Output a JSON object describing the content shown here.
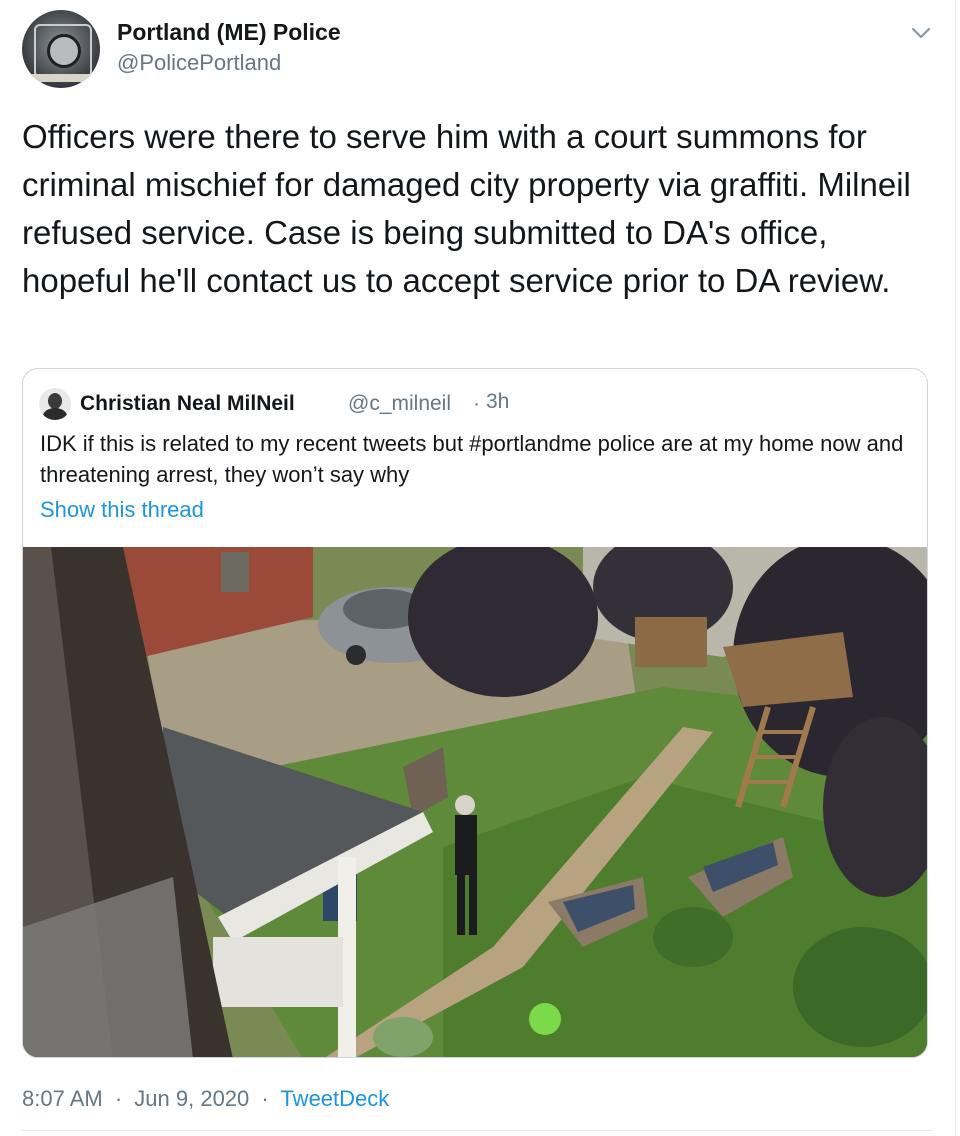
{
  "tweet": {
    "author": {
      "name": "Portland (ME) Police",
      "handle": "@PolicePortland",
      "avatar_icon": "police-badge-avatar"
    },
    "menu_icon": "chevron-down-icon",
    "text": "Officers were there to serve him with a court summons for criminal mischief for damaged city property via graffiti. Milneil refused service. Case is being submitted to DA's office, hopeful he'll contact us to accept service prior to DA review.",
    "timestamp": "8:07 AM",
    "date": "Jun 9, 2020",
    "separator": "·",
    "source": "TweetDeck"
  },
  "quoted": {
    "author": {
      "name": "Christian Neal MilNeil",
      "handle": "@c_milneil",
      "avatar_icon": "person-avatar"
    },
    "separator": "·",
    "time": "3h",
    "text": "IDK if this is related to my recent tweets but #portlandme police are at my home now and threatening arrest, they won’t say why",
    "show_thread": "Show this thread",
    "photo": "aerial-yard-photo"
  },
  "colors": {
    "link": "#1b95e0",
    "secondary_text": "#657786",
    "primary_text": "#14171a",
    "border": "#ccd6dd"
  }
}
